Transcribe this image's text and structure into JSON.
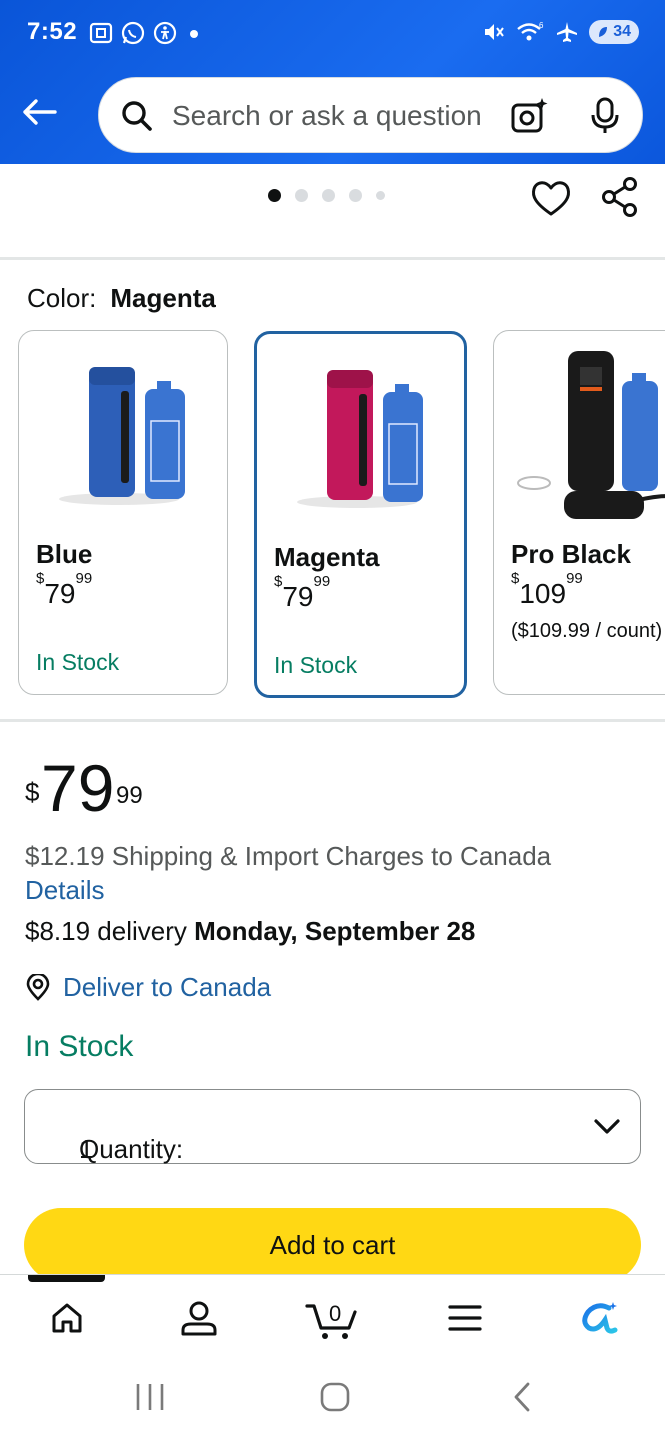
{
  "status_bar": {
    "time": "7:52",
    "battery": "34",
    "icons_left": [
      "screenshot-icon",
      "whatsapp-icon",
      "accessibility-icon",
      "dot-icon"
    ],
    "icons_right": [
      "mute-icon",
      "wifi-icon",
      "airplane-icon",
      "battery-icon"
    ]
  },
  "header": {
    "search_placeholder": "Search or ask a question"
  },
  "gallery": {
    "dots": 5,
    "active_dot": 0
  },
  "color": {
    "label": "Color:",
    "selected": "Magenta",
    "options": [
      {
        "name": "Blue",
        "price_symbol": "$",
        "price_whole": "79",
        "price_fraction": "99",
        "unit_price": "",
        "stock": "In Stock",
        "body_color": "#2d5fb8",
        "selected": false
      },
      {
        "name": "Magenta",
        "price_symbol": "$",
        "price_whole": "79",
        "price_fraction": "99",
        "unit_price": "",
        "stock": "In Stock",
        "body_color": "#c2185b",
        "selected": true
      },
      {
        "name": "Pro Black",
        "price_symbol": "$",
        "price_whole": "109",
        "price_fraction": "99",
        "unit_price": "($109.99 / count)",
        "stock": "",
        "body_color": "#1a1a1a",
        "selected": false
      }
    ]
  },
  "price": {
    "symbol": "$",
    "whole": "79",
    "fraction": "99"
  },
  "shipping": {
    "charges": "$12.19 Shipping & Import Charges to Canada",
    "details_link": "Details",
    "delivery_prefix": "$8.19 delivery ",
    "delivery_date": "Monday, September 28",
    "deliver_to": "Deliver to Canada",
    "stock": "In Stock"
  },
  "quantity": {
    "label": "Quantity:",
    "value": "1"
  },
  "buttons": {
    "add_to_cart": "Add to cart"
  },
  "bottom_nav": [
    "home-icon",
    "account-icon",
    "cart-icon",
    "menu-icon",
    "rufus-icon"
  ],
  "cart_count": "0",
  "colors": {
    "accent_blue": "#2162a1",
    "in_stock_green": "#067d62",
    "add_to_cart_yellow": "#ffd814",
    "header_blue": "#1a6cf0"
  }
}
